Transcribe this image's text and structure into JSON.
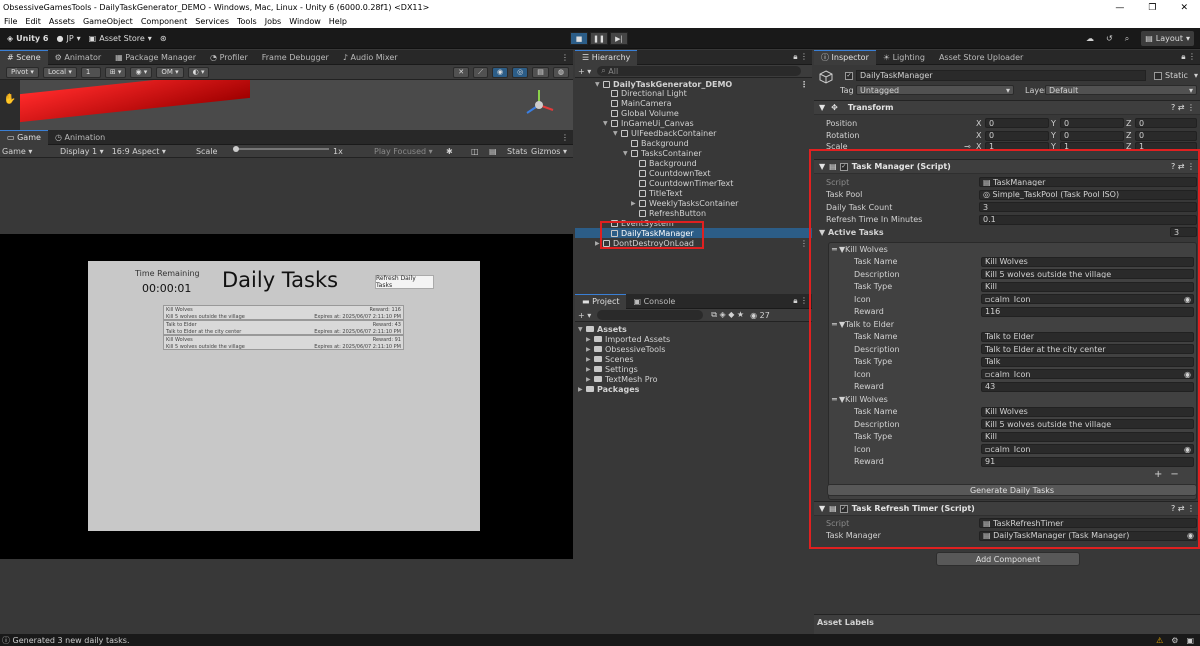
{
  "window": {
    "title": "ObsessiveGamesTools - DailyTaskGenerator_DEMO - Windows, Mac, Linux - Unity 6 (6000.0.28f1) <DX11>",
    "minimize": "—",
    "maximize": "❐",
    "close": "✕"
  },
  "menu": [
    "File",
    "Edit",
    "Assets",
    "GameObject",
    "Component",
    "Services",
    "Tools",
    "Jobs",
    "Window",
    "Help"
  ],
  "toolbar": {
    "unity": "Unity 6",
    "account": "JP",
    "asset_store": "Asset Store",
    "layout": "Layout"
  },
  "scene_tabs": [
    "Scene",
    "Animator",
    "Package Manager",
    "Profiler",
    "Frame Debugger",
    "Audio Mixer"
  ],
  "scene_toolbar": {
    "pivot": "Pivot",
    "local": "Local",
    "grid": "1",
    "view": "OM"
  },
  "game_tabs": [
    "Game",
    "Animation"
  ],
  "game_toolbar": {
    "game": "Game",
    "display": "Display 1",
    "aspect": "16:9 Aspect",
    "scale_label": "Scale",
    "scale_value": "1x",
    "play_focused": "Play Focused",
    "stats": "Stats",
    "gizmos": "Gizmos"
  },
  "game_view": {
    "time_remaining_label": "Time Remaining",
    "timer": "00:00:01",
    "title": "Daily Tasks",
    "refresh_button": "Refresh Daily Tasks",
    "tasks": [
      {
        "name": "Kill Wolves",
        "reward": "Reward: 116",
        "desc": "Kill 5 wolves outside the village",
        "expires": "Expires at: 2025/06/07 2:11:10 PM"
      },
      {
        "name": "Talk to Elder",
        "reward": "Reward: 43",
        "desc": "Talk to Elder at the city center",
        "expires": "Expires at: 2025/06/07 2:11:10 PM"
      },
      {
        "name": "Kill Wolves",
        "reward": "Reward: 91",
        "desc": "Kill 5 wolves outside the village",
        "expires": "Expires at: 2025/06/07 2:11:10 PM"
      }
    ]
  },
  "hierarchy": {
    "tab": "Hierarchy",
    "search": "All",
    "items": [
      {
        "label": "DailyTaskGenerator_DEMO"
      },
      {
        "label": "Directional Light"
      },
      {
        "label": "MainCamera"
      },
      {
        "label": "Global Volume"
      },
      {
        "label": "InGameUi_Canvas"
      },
      {
        "label": "UIFeedbackContainer"
      },
      {
        "label": "Background"
      },
      {
        "label": "TasksContainer"
      },
      {
        "label": "Background"
      },
      {
        "label": "CountdownText"
      },
      {
        "label": "CountdownTimerText"
      },
      {
        "label": "TitleText"
      },
      {
        "label": "WeeklyTasksContainer"
      },
      {
        "label": "RefreshButton"
      },
      {
        "label": "EventSystem"
      },
      {
        "label": "DailyTaskManager"
      },
      {
        "label": "DontDestroyOnLoad"
      }
    ]
  },
  "project": {
    "tabs": [
      "Project",
      "Console"
    ],
    "count": "27",
    "items": [
      {
        "label": "Assets"
      },
      {
        "label": "Imported Assets"
      },
      {
        "label": "ObsessiveTools"
      },
      {
        "label": "Scenes"
      },
      {
        "label": "Settings"
      },
      {
        "label": "TextMesh Pro"
      },
      {
        "label": "Packages"
      }
    ]
  },
  "inspector": {
    "tabs": [
      "Inspector",
      "Lighting",
      "Asset Store Uploader"
    ],
    "object_name": "DailyTaskManager",
    "static": "Static",
    "tag_label": "Tag",
    "tag_value": "Untagged",
    "layer_label": "Layer",
    "layer_value": "Default",
    "transform": {
      "title": "Transform",
      "rows": [
        {
          "label": "Position",
          "x": "0",
          "y": "0",
          "z": "0"
        },
        {
          "label": "Rotation",
          "x": "0",
          "y": "0",
          "z": "0"
        },
        {
          "label": "Scale",
          "x": "1",
          "y": "1",
          "z": "1"
        }
      ],
      "x": "X",
      "y": "Y",
      "z": "Z"
    },
    "task_manager": {
      "title": "Task Manager (Script)",
      "script_label": "Script",
      "script_value": "TaskManager",
      "pool_label": "Task Pool",
      "pool_value": "Simple_TaskPool (Task Pool ISO)",
      "count_label": "Daily Task Count",
      "count_value": "3",
      "refresh_label": "Refresh Time In Minutes",
      "refresh_value": "0.1",
      "active_label": "Active Tasks",
      "active_count": "3",
      "field_labels": {
        "name": "Task Name",
        "desc": "Description",
        "type": "Task Type",
        "icon": "Icon",
        "reward": "Reward"
      },
      "tasks": [
        {
          "header": "Kill Wolves",
          "name": "Kill Wolves",
          "desc": "Kill 5 wolves outside the village",
          "type": "Kill",
          "icon": "calm_Icon",
          "reward": "116"
        },
        {
          "header": "Talk to Elder",
          "name": "Talk to Elder",
          "desc": "Talk to Elder at the city center",
          "type": "Talk",
          "icon": "calm_Icon",
          "reward": "43"
        },
        {
          "header": "Kill Wolves",
          "name": "Kill Wolves",
          "desc": "Kill 5 wolves outside the village",
          "type": "Kill",
          "icon": "calm_Icon",
          "reward": "91"
        }
      ],
      "plus": "+",
      "minus": "−",
      "generate_button": "Generate Daily Tasks"
    },
    "refresh_timer": {
      "title": "Task Refresh Timer (Script)",
      "script_label": "Script",
      "script_value": "TaskRefreshTimer",
      "manager_label": "Task Manager",
      "manager_value": "DailyTaskManager (Task Manager)"
    },
    "add_component": "Add Component",
    "asset_labels": "Asset Labels"
  },
  "status": {
    "message": "Generated 3 new daily tasks."
  }
}
